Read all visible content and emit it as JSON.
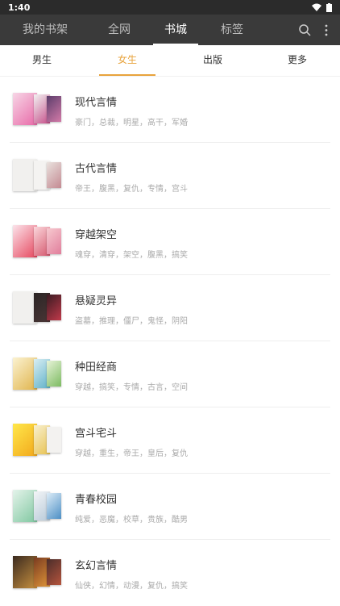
{
  "status": {
    "time": "1:40"
  },
  "top_nav": {
    "tabs": [
      {
        "label": "我的书架"
      },
      {
        "label": "全网"
      },
      {
        "label": "书城"
      },
      {
        "label": "标签"
      }
    ],
    "active_index": 2
  },
  "sub_tabs": {
    "tabs": [
      {
        "label": "男生"
      },
      {
        "label": "女生"
      },
      {
        "label": "出版"
      },
      {
        "label": "更多"
      }
    ],
    "active_index": 1
  },
  "categories": [
    {
      "title": "现代言情",
      "tags": "豪门，总裁，明星，高干，军婚"
    },
    {
      "title": "古代言情",
      "tags": "帝王，腹黑，复仇，专情，宫斗"
    },
    {
      "title": "穿越架空",
      "tags": "魂穿，清穿，架空，腹黑，搞笑"
    },
    {
      "title": "悬疑灵异",
      "tags": "盗墓，推理，僵尸，鬼怪，阴阳"
    },
    {
      "title": "种田经商",
      "tags": "穿越，搞笑，专情，古言，空间"
    },
    {
      "title": "宫斗宅斗",
      "tags": "穿越，重生，帝王，皇后，复仇"
    },
    {
      "title": "青春校园",
      "tags": "纯爱，恶魔，校草，贵族，酷男"
    },
    {
      "title": "玄幻言情",
      "tags": "仙侠，幻情，动漫，复仇，搞笑"
    }
  ],
  "colors": {
    "status_bg": "#2b2b2b",
    "nav_bg": "#3a3a3a",
    "accent": "#e8a33c"
  }
}
